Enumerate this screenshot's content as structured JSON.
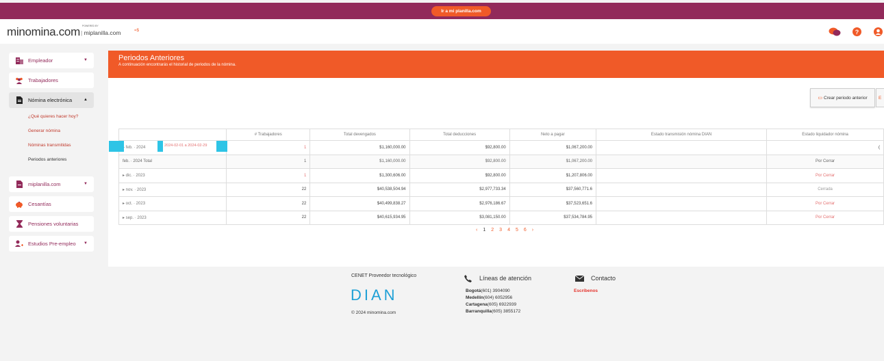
{
  "topbar": {
    "button_label": "Ir a mi planilla.com"
  },
  "header": {
    "logo_text": "minomina.com",
    "powered_by": "POWERED BY",
    "sub_brand": "miplanilla.com",
    "flag_text": "=$"
  },
  "sidebar": {
    "items": [
      {
        "label": "Empleador",
        "icon": "building-icon",
        "has_caret": true
      },
      {
        "label": "Trabajadores",
        "icon": "people-icon",
        "has_caret": false
      },
      {
        "label": "Nómina electrónica",
        "icon": "document-icon",
        "has_caret": true
      },
      {
        "label": "miplanilla.com",
        "icon": "file-icon",
        "has_caret": true
      },
      {
        "label": "Cesantías",
        "icon": "piggy-bank-icon",
        "has_caret": false
      },
      {
        "label": "Pensiones voluntarias",
        "icon": "hourglass-icon",
        "has_caret": false
      },
      {
        "label": "Estudios Pre-empleo",
        "icon": "person-plus-icon",
        "has_caret": true
      }
    ],
    "sub_items": [
      "¿Qué quieres hacer hoy?",
      "Generar nómina",
      "Nóminas transmitidas",
      "Periodos anteriores"
    ]
  },
  "banner": {
    "title": "Periodos Anteriores",
    "subtitle": "A continuación encontrarás el historial de periodos de la nómina."
  },
  "actions": {
    "create_label": "Crear periodo anterior",
    "export_label": "E"
  },
  "table": {
    "headers": [
      "",
      "# Trabajadores",
      "Total devengados",
      "Total deducciones",
      "Neto a pagar",
      "Estado transmisión nómina DIAN",
      "Estado liquidador nómina"
    ],
    "rows": [
      {
        "period": "▸ feb. · 2024",
        "workers": "1",
        "devengados": "$1,160,000.00",
        "deducciones": "$92,800.00",
        "neto": "$1,067,200.00",
        "dian": "",
        "liquidador": ""
      },
      {
        "period": "feb. · 2024 Total",
        "workers": "1",
        "devengados": "$1,160,000.00",
        "deducciones": "$92,800.00",
        "neto": "$1,067,200.00",
        "dian": "",
        "liquidador": "Por Cerrar"
      },
      {
        "period": "▸ dic. · 2023",
        "workers": "1",
        "devengados": "$1,300,606.00",
        "deducciones": "$92,800.00",
        "neto": "$1,207,806.00",
        "dian": "",
        "liquidador": "Por Cerrar"
      },
      {
        "period": "▸ nov. · 2023",
        "workers": "22",
        "devengados": "$40,538,504.94",
        "deducciones": "$2,977,733.34",
        "neto": "$37,560,771.6",
        "dian": "",
        "liquidador": "Cerrada"
      },
      {
        "period": "▸ oct. · 2023",
        "workers": "22",
        "devengados": "$40,499,838.27",
        "deducciones": "$2,976,186.67",
        "neto": "$37,523,651.6",
        "dian": "",
        "liquidador": "Por Cerrar"
      },
      {
        "period": "▸ sep. · 2023",
        "workers": "22",
        "devengados": "$40,615,934.95",
        "deducciones": "$3,081,150.00",
        "neto": "$37,534,784.95",
        "dian": "",
        "liquidador": "Por Cerrar"
      }
    ],
    "first_row_date": "2024-02-01 a 2024-02-29",
    "first_row_tail": "("
  },
  "pagination": {
    "prev": "‹",
    "pages": [
      "1",
      "2",
      "3",
      "4",
      "5",
      "6"
    ],
    "next": "›",
    "current": "1"
  },
  "footer": {
    "provider": "CENET Proveedor tecnológico",
    "dian_logo": "DIAN",
    "copyright": "© 2024 minomina.com",
    "lines_title": "Líneas de atención",
    "lines": [
      {
        "city": "Bogotá",
        "phone": "(601) 3904090"
      },
      {
        "city": "Medellín",
        "phone": "(604) 6052956"
      },
      {
        "city": "Cartagena",
        "phone": "(605) 6922939"
      },
      {
        "city": "Barranquilla",
        "phone": "(605) 3855172"
      }
    ],
    "contact_title": "Contacto",
    "contact_link": "Escríbenos"
  },
  "colors": {
    "brand_purple": "#922a5a",
    "accent_orange": "#f05a28",
    "dian_blue": "#1ea0d6"
  }
}
